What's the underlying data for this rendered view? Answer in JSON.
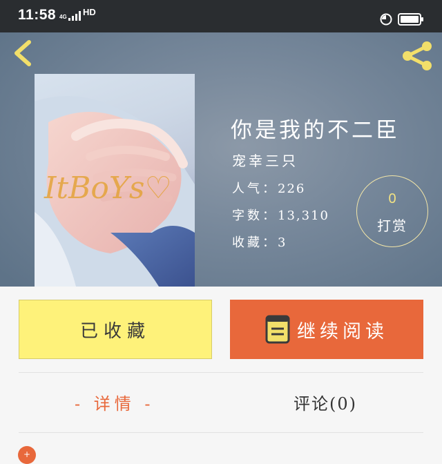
{
  "status_bar": {
    "time": "11:58",
    "network": "4G",
    "hd": "HD"
  },
  "book": {
    "title": "你是我的不二臣",
    "author": "宠幸三只",
    "popularity_label": "人气：",
    "popularity_value": "226",
    "wordcount_label": "字数：",
    "wordcount_value": "13,310",
    "favorites_label": "收藏：",
    "favorites_value": "3",
    "cover_watermark": "ItBoYs♡"
  },
  "tip": {
    "count": "0",
    "label": "打赏"
  },
  "actions": {
    "collected_label": "已收藏",
    "continue_label": "继续阅读"
  },
  "tabs": {
    "detail_label": "- 详情 -",
    "comment_label": "评论(0)"
  },
  "colors": {
    "accent": "#e8683b",
    "collect_bg": "#fef27a",
    "icon_yellow": "#f2df6a"
  },
  "icons": [
    "back-chevron-icon",
    "share-icon",
    "book-icon"
  ]
}
